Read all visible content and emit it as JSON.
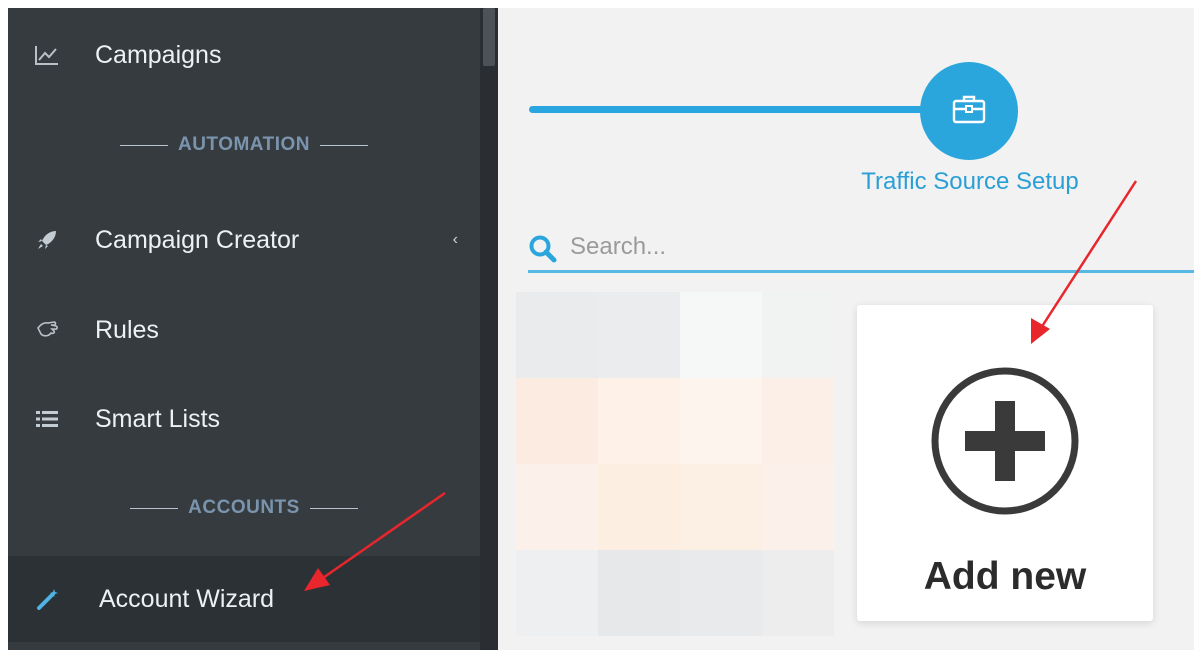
{
  "sidebar": {
    "items": [
      {
        "label": "Campaigns",
        "icon": "chart-line-icon"
      },
      {
        "label": "Campaign Creator",
        "icon": "rocket-icon"
      },
      {
        "label": "Rules",
        "icon": "hand-icon"
      },
      {
        "label": "Smart Lists",
        "icon": "list-icon"
      },
      {
        "label": "Account Wizard",
        "icon": "magic-wand-icon"
      }
    ],
    "sections": {
      "automation": "AUTOMATION",
      "accounts": "ACCOUNTS"
    },
    "expand_chevron": "‹"
  },
  "wizard": {
    "step_label": "Traffic Source Setup",
    "step_icon": "briefcase-icon"
  },
  "search": {
    "placeholder": "Search..."
  },
  "add_card": {
    "label": "Add new",
    "icon": "plus-circle-icon"
  },
  "colors": {
    "sidebar_bg": "#363b40",
    "accent": "#2aa6dd",
    "arrow": "#e8262c"
  }
}
